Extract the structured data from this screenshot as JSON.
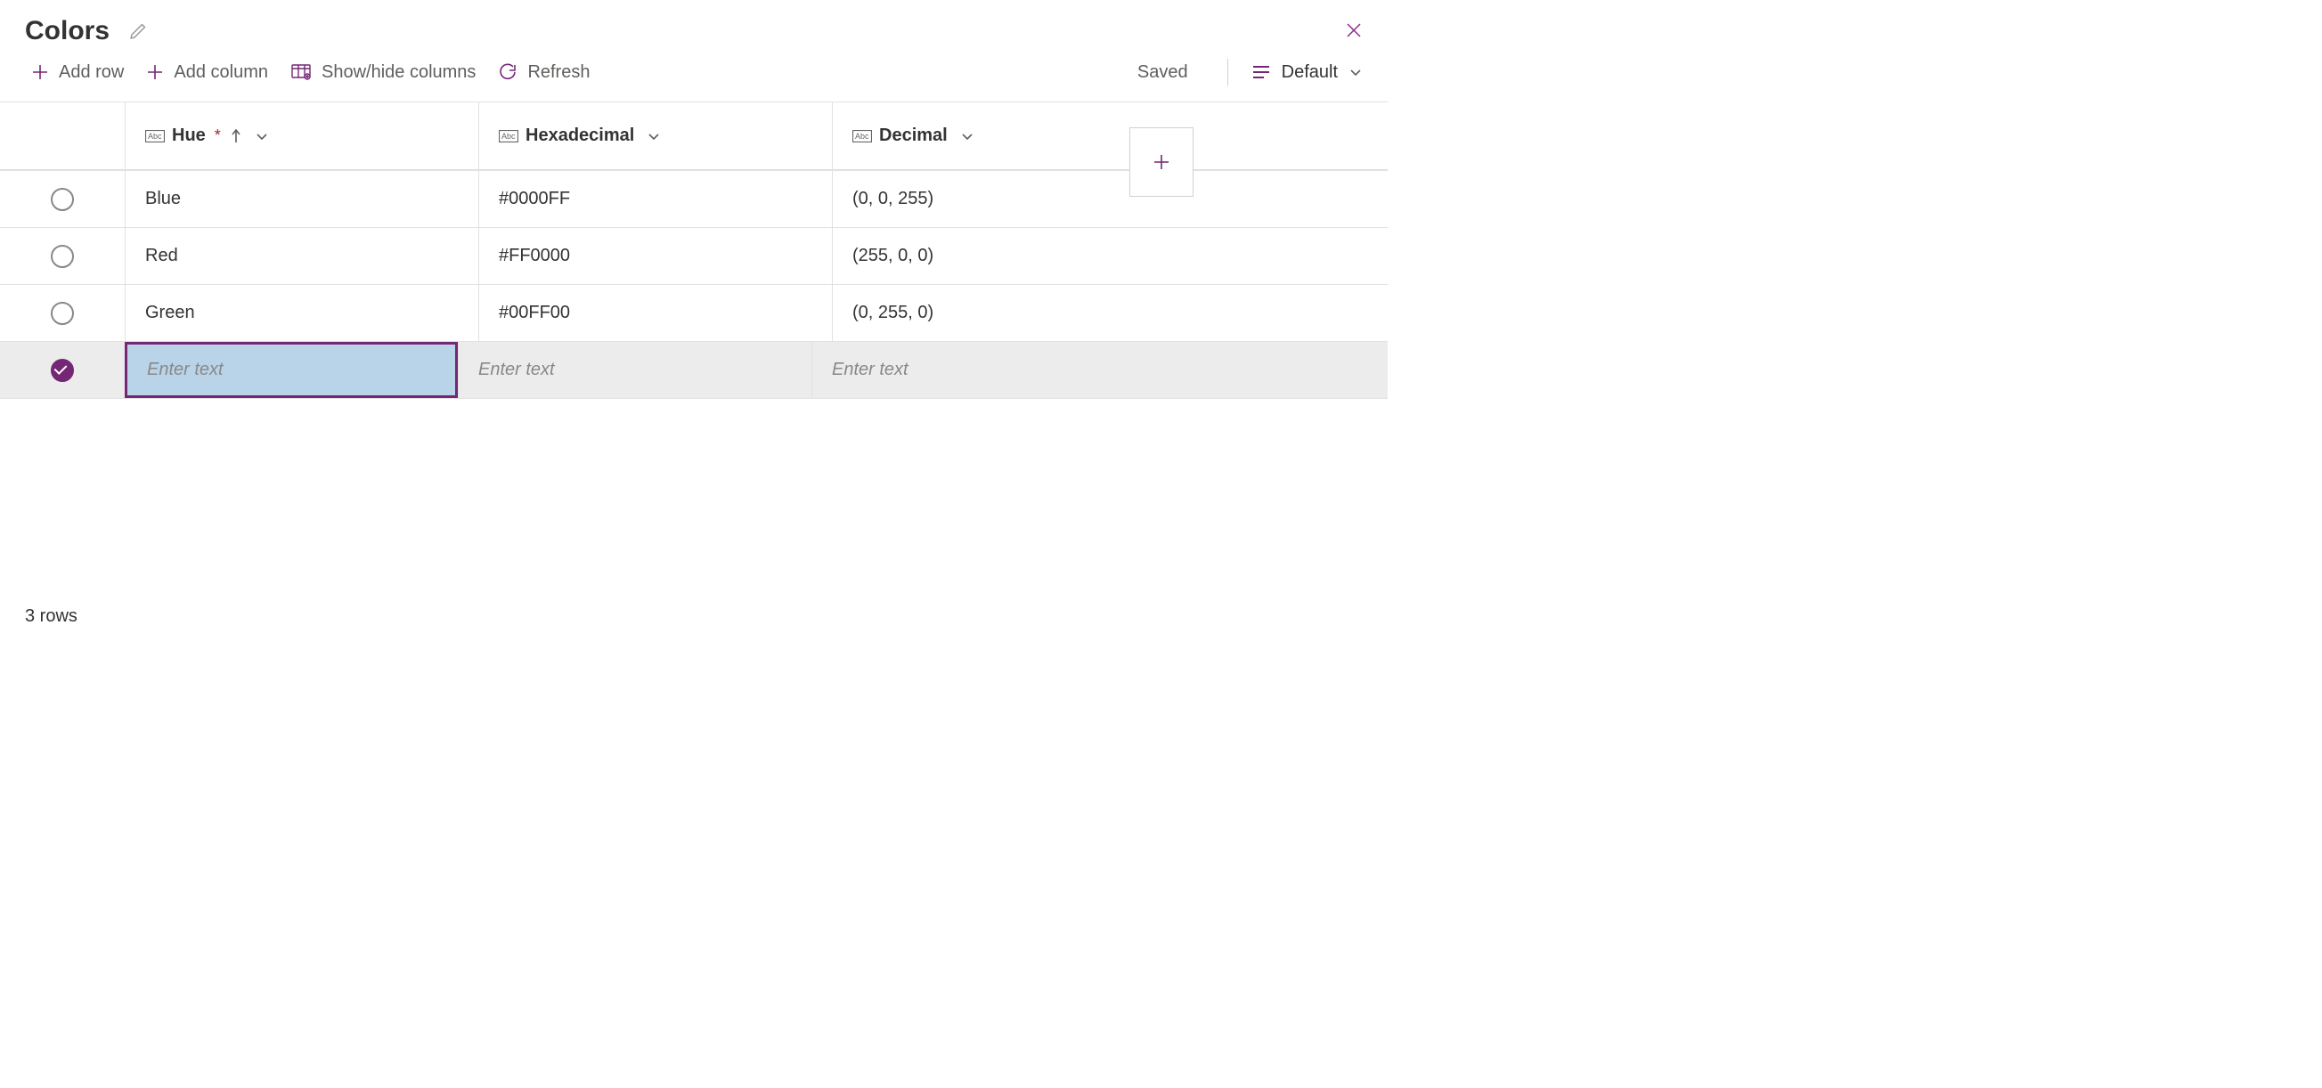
{
  "title": "Colors",
  "toolbar": {
    "add_row": "Add row",
    "add_column": "Add column",
    "show_hide": "Show/hide columns",
    "refresh": "Refresh",
    "status": "Saved",
    "view": "Default"
  },
  "columns": {
    "hue": {
      "label": "Hue",
      "required": true,
      "sort": "asc"
    },
    "hex": {
      "label": "Hexadecimal"
    },
    "dec": {
      "label": "Decimal"
    }
  },
  "rows": [
    {
      "hue": "Blue",
      "hex": "#0000FF",
      "dec": "(0, 0, 255)"
    },
    {
      "hue": "Red",
      "hex": "#FF0000",
      "dec": "(255, 0, 0)"
    },
    {
      "hue": "Green",
      "hex": "#00FF00",
      "dec": "(0, 255, 0)"
    }
  ],
  "new_row": {
    "placeholder": "Enter text"
  },
  "footer": {
    "count": "3 rows"
  },
  "colors": {
    "accent": "#742774"
  }
}
